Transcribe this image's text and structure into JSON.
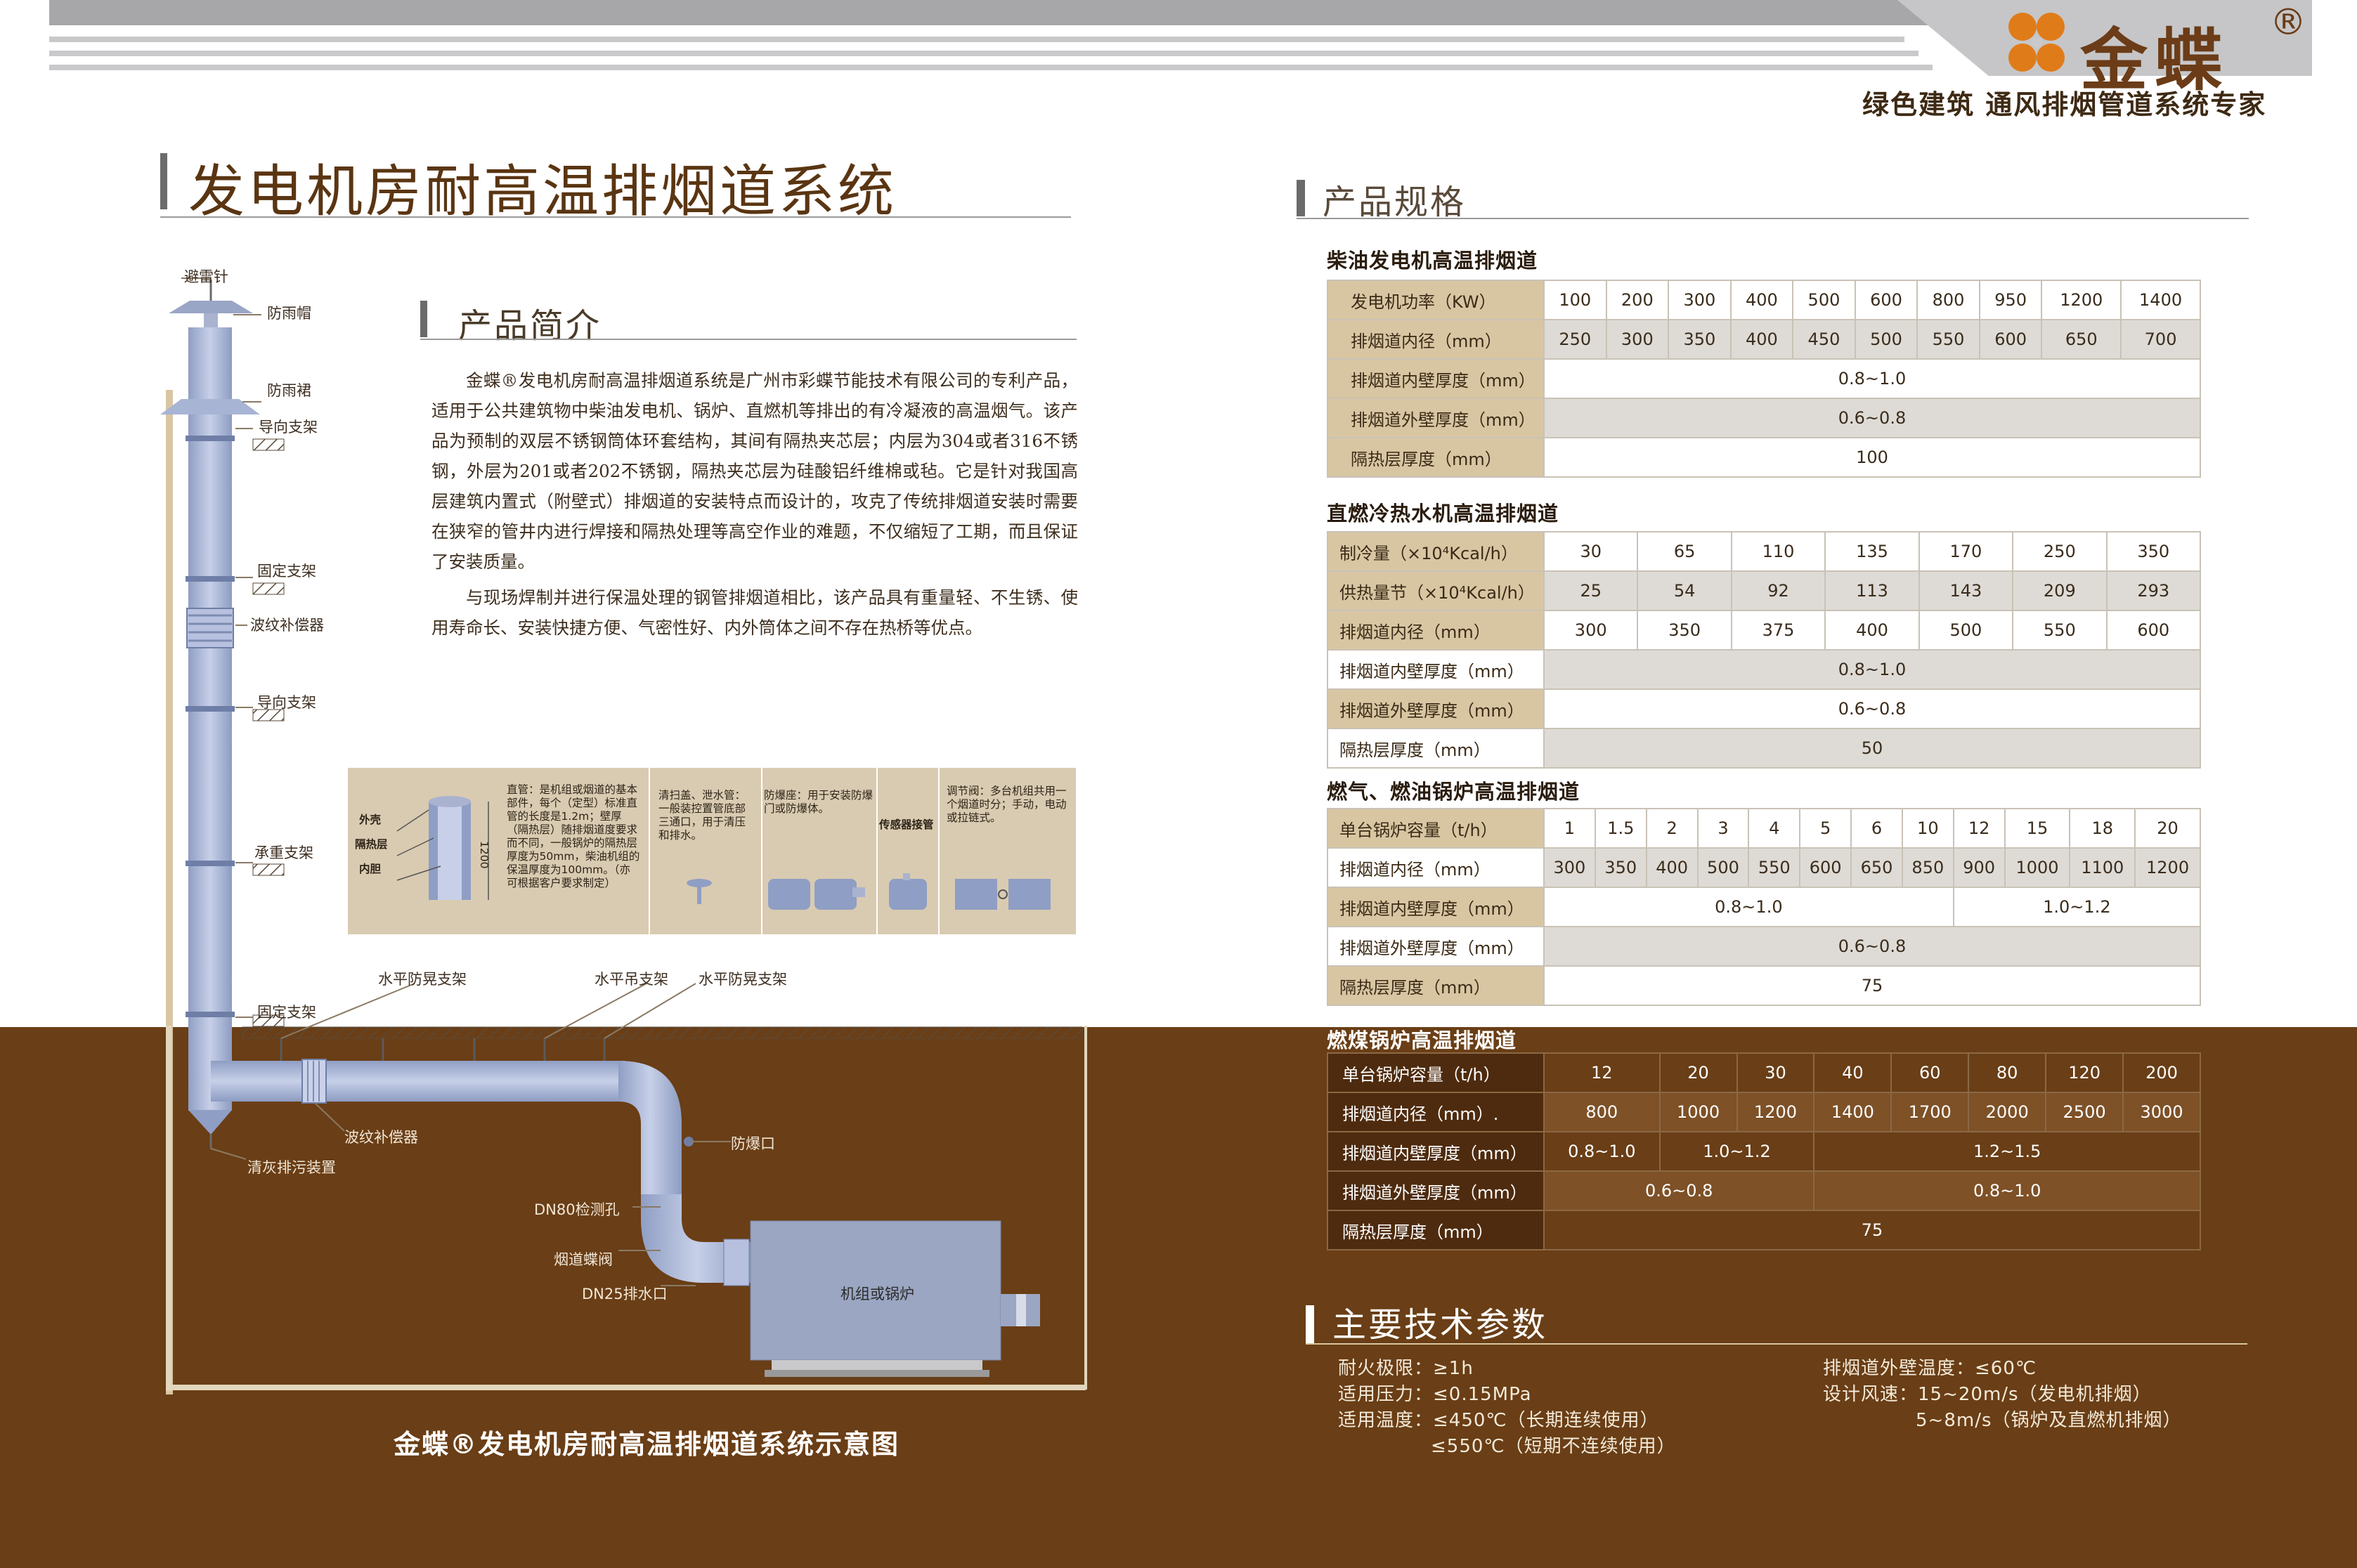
{
  "brand": {
    "name": "金蝶",
    "registered": "®",
    "slogan": "绿色建筑  通风排烟管道系统专家",
    "colors": {
      "brown": "#6b3c17",
      "orange": "#e07b1a"
    }
  },
  "main_title": "发电机房耐高温排烟道系统",
  "intro": {
    "heading": "产品简介",
    "paragraphs": [
      "金蝶®发电机房耐高温排烟道系统是广州市彩蝶节能技术有限公司的专利产品，适用于公共建筑物中柴油发电机、锅炉、直燃机等排出的有冷凝液的高温烟气。该产品为预制的双层不锈钢筒体环套结构，其间有隔热夹芯层；内层为304或者316不锈钢，外层为201或者202不锈钢，隔热夹芯层为硅酸铝纤维棉或毡。它是针对我国高层建筑内置式（附壁式）排烟道的安装特点而设计的，攻克了传统排烟道安装时需要在狭窄的管井内进行焊接和隔热处理等高空作业的难题，不仅缩短了工期，而且保证了安装质量。",
      "与现场焊制并进行保温处理的钢管排烟道相比，该产品具有重量轻、不生锈、使用寿命长、安装快捷方便、气密性好、内外筒体之间不存在热桥等优点。"
    ]
  },
  "diagram": {
    "caption": "金蝶®发电机房耐高温排烟道系统示意图",
    "labels": {
      "lightning": "避雷针",
      "rain_cap": "防雨帽",
      "rain_skirt": "防雨裙",
      "guide1": "导向支架",
      "fixed1": "固定支架",
      "bellows1": "波纹补偿器",
      "guide2": "导向支架",
      "load": "承重支架",
      "fixed2": "固定支架",
      "h_anti1": "水平防晃支架",
      "h_hang": "水平吊支架",
      "h_anti2": "水平防晃支架",
      "bellows2": "波纹补偿器",
      "ash": "清灰排污装置",
      "explosion": "防爆口",
      "dn80": "DN80检测孔",
      "damper": "烟道蝶阀",
      "dn25": "DN25排水口",
      "unit": "机组或锅炉"
    },
    "detail": {
      "layers": [
        "外壳",
        "隔热层",
        "内胆"
      ],
      "dim": "1200",
      "straight": "直管：是机组或烟道的基本部件，每个（定型）标准直管的长度是1.2m；壁厚（隔热层）随排烟道度要求而不同，一般锅炉的隔热层厚度为50mm，柴油机组的保温厚度为100mm。（亦可根据客户要求制定）",
      "clean": "清扫盖、泄水管：一般装控置管底部三通口，用于清压和排水。",
      "explosion": "防爆座：用于安装防爆门或防爆体。",
      "sensor": "传感器接管",
      "damper": "调节阀：多台机组共用一个烟道时分；手动，电动或拉链式。"
    }
  },
  "spec": {
    "heading": "产品规格",
    "t1": {
      "title": "柴油发电机高温排烟道",
      "rows": [
        {
          "label": "发电机功率（KW）",
          "values": [
            "100",
            "200",
            "300",
            "400",
            "500",
            "600",
            "800",
            "950",
            "1200",
            "1400"
          ]
        },
        {
          "label": "排烟道内径（mm）",
          "values": [
            "250",
            "300",
            "350",
            "400",
            "450",
            "500",
            "550",
            "600",
            "650",
            "700"
          ]
        },
        {
          "label": "排烟道内壁厚度（mm）",
          "value": "0.8~1.0"
        },
        {
          "label": "排烟道外壁厚度（mm）",
          "value": "0.6~0.8"
        },
        {
          "label": "隔热层厚度（mm）",
          "value": "100"
        }
      ]
    },
    "t2": {
      "title": "直燃冷热水机高温排烟道",
      "rows": [
        {
          "label": "制冷量（×10⁴Kcal/h）",
          "values": [
            "30",
            "65",
            "110",
            "135",
            "170",
            "250",
            "350"
          ]
        },
        {
          "label": "供热量节（×10⁴Kcal/h）",
          "values": [
            "25",
            "54",
            "92",
            "113",
            "143",
            "209",
            "293"
          ]
        },
        {
          "label": "排烟道内径（mm）",
          "values": [
            "300",
            "350",
            "375",
            "400",
            "500",
            "550",
            "600"
          ]
        },
        {
          "label": "排烟道内壁厚度（mm）",
          "value": "0.8~1.0"
        },
        {
          "label": "排烟道外壁厚度（mm）",
          "value": "0.6~0.8"
        },
        {
          "label": "隔热层厚度（mm）",
          "value": "50"
        }
      ]
    },
    "t3": {
      "title": "燃气、燃油锅炉高温排烟道",
      "rows": [
        {
          "label": "单台锅炉容量（t/h）",
          "values": [
            "1",
            "1.5",
            "2",
            "3",
            "4",
            "5",
            "6",
            "10",
            "12",
            "15",
            "18",
            "20"
          ]
        },
        {
          "label": "排烟道内径（mm）",
          "values": [
            "300",
            "350",
            "400",
            "500",
            "550",
            "600",
            "650",
            "850",
            "900",
            "1000",
            "1100",
            "1200"
          ]
        },
        {
          "label": "排烟道内壁厚度（mm）",
          "a": "0.8~1.0",
          "b": "1.0~1.2"
        },
        {
          "label": "排烟道外壁厚度（mm）",
          "value": "0.6~0.8"
        },
        {
          "label": "隔热层厚度（mm）",
          "value": "75"
        }
      ]
    },
    "t4": {
      "title": "燃煤锅炉高温排烟道",
      "rows": [
        {
          "label": "单台锅炉容量（t/h）",
          "values": [
            "12",
            "20",
            "30",
            "40",
            "60",
            "80",
            "120",
            "200"
          ]
        },
        {
          "label": "排烟道内径（mm）.",
          "values": [
            "800",
            "1000",
            "1200",
            "1400",
            "1700",
            "2000",
            "2500",
            "3000"
          ]
        },
        {
          "label": "排烟道内壁厚度（mm）",
          "a": "0.8~1.0",
          "b": "1.0~1.2",
          "c": "1.2~1.5"
        },
        {
          "label": "排烟道外壁厚度（mm）",
          "a": "0.6~0.8",
          "b": "0.8~1.0"
        },
        {
          "label": "隔热层厚度（mm）",
          "value": "75"
        }
      ]
    }
  },
  "tech": {
    "heading": "主要技术参数",
    "left": [
      "耐火极限：≥1h",
      "适用压力：≤0.15MPa",
      "适用温度：≤450℃（长期连续使用）",
      "≤550℃（短期不连续使用）"
    ],
    "right": [
      "排烟道外壁温度：≤60℃",
      "设计风速：15~20m/s（发电机排烟）",
      "5~8m/s（锅炉及直燃机排烟）"
    ]
  }
}
